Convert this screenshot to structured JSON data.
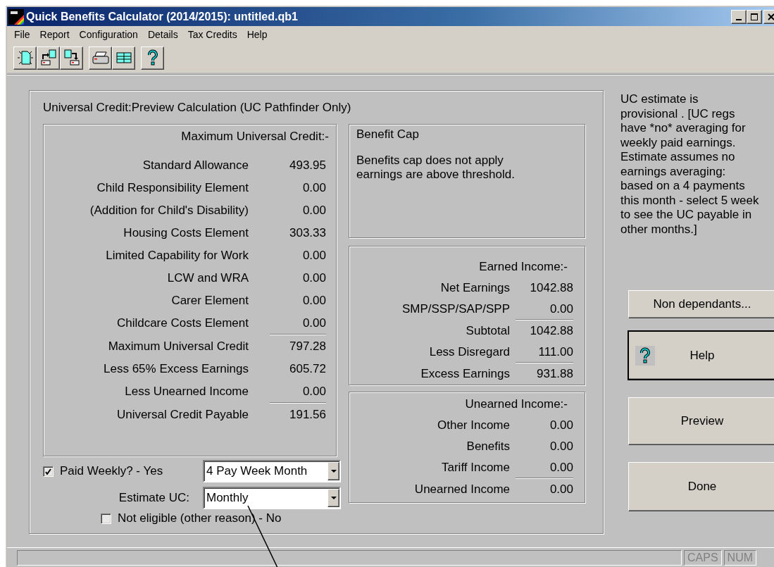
{
  "window": {
    "title": "Quick Benefits Calculator (2014/2015): untitled.qb1"
  },
  "menu": [
    "File",
    "Report",
    "Configuration",
    "Details",
    "Tax Credits",
    "Help"
  ],
  "calculation": {
    "title": "Universal Credit:Preview Calculation (UC Pathfinder Only)",
    "maximum": {
      "heading": "Maximum Universal Credit:-",
      "rows": [
        {
          "label": "Standard Allowance",
          "value": "493.95",
          "rule_below": false
        },
        {
          "label": "Child Responsibility Element",
          "value": "0.00",
          "rule_below": false
        },
        {
          "label": "(Addition for Child's Disability)",
          "value": "0.00",
          "rule_below": false
        },
        {
          "label": "Housing Costs Element",
          "value": "303.33",
          "rule_below": false
        },
        {
          "label": "Limited Capability for Work",
          "value": "0.00",
          "rule_below": false
        },
        {
          "label": "LCW and WRA",
          "value": "0.00",
          "rule_below": false
        },
        {
          "label": "Carer Element",
          "value": "0.00",
          "rule_below": false
        },
        {
          "label": "Childcare Costs Element",
          "value": "0.00",
          "rule_below": true
        },
        {
          "label": "Maximum Universal Credit",
          "value": "797.28",
          "rule_below": false
        },
        {
          "label": "Less 65% Excess Earnings",
          "value": "605.72",
          "rule_below": false
        },
        {
          "label": "Less Unearned Income",
          "value": "0.00",
          "rule_below": true
        },
        {
          "label": "Universal Credit Payable",
          "value": "191.56",
          "rule_below": false
        }
      ]
    },
    "benefit_cap": {
      "title": "Benefit Cap",
      "lines": [
        "Benefits cap does not apply",
        "earnings are above threshold."
      ]
    },
    "earned_income": {
      "heading": "Earned Income:-",
      "rows": [
        {
          "label": "Net Earnings",
          "value": "1042.88",
          "rule_below": false
        },
        {
          "label": "SMP/SSP/SAP/SPP",
          "value": "0.00",
          "rule_below": true
        },
        {
          "label": "Subtotal",
          "value": "1042.88",
          "rule_below": false
        },
        {
          "label": "Less Disregard",
          "value": "111.00",
          "rule_below": true
        },
        {
          "label": "Excess Earnings",
          "value": "931.88",
          "rule_below": false
        }
      ]
    },
    "unearned_income": {
      "heading": "Unearned Income:-",
      "rows": [
        {
          "label": "Other Income",
          "value": "0.00",
          "rule_below": false
        },
        {
          "label": "Benefits",
          "value": "0.00",
          "rule_below": false
        },
        {
          "label": "Tariff Income",
          "value": "0.00",
          "rule_below": true
        },
        {
          "label": "Unearned Income",
          "value": "0.00",
          "rule_below": false
        }
      ]
    },
    "paid_weekly": {
      "label": "Paid Weekly? - Yes",
      "checked": true
    },
    "pay_period": {
      "value": "4 Pay Week Month"
    },
    "estimate": {
      "label": "Estimate UC:",
      "value": "Monthly"
    },
    "not_eligible": {
      "label": "Not eligible (other reason) - No",
      "checked": false
    }
  },
  "note": [
    "UC estimate is",
    "provisional . [UC regs",
    "have *no* averaging for",
    "weekly paid earnings.",
    "Estimate assumes no",
    "earnings averaging:",
    "based on a 4 payments",
    "this month - select 5 week",
    "to see the UC payable in",
    "other months.]"
  ],
  "buttons": [
    {
      "label": "Non dependants...",
      "kind": "plain",
      "default": false
    },
    {
      "label": "Help",
      "kind": "help",
      "default": true
    },
    {
      "label": "Preview",
      "kind": "plain",
      "default": false
    },
    {
      "label": "Done",
      "kind": "plain",
      "default": false
    }
  ],
  "status_bar": {
    "indicators": [
      {
        "label": "CAPS",
        "active": false
      },
      {
        "label": "NUM",
        "active": false
      }
    ]
  }
}
